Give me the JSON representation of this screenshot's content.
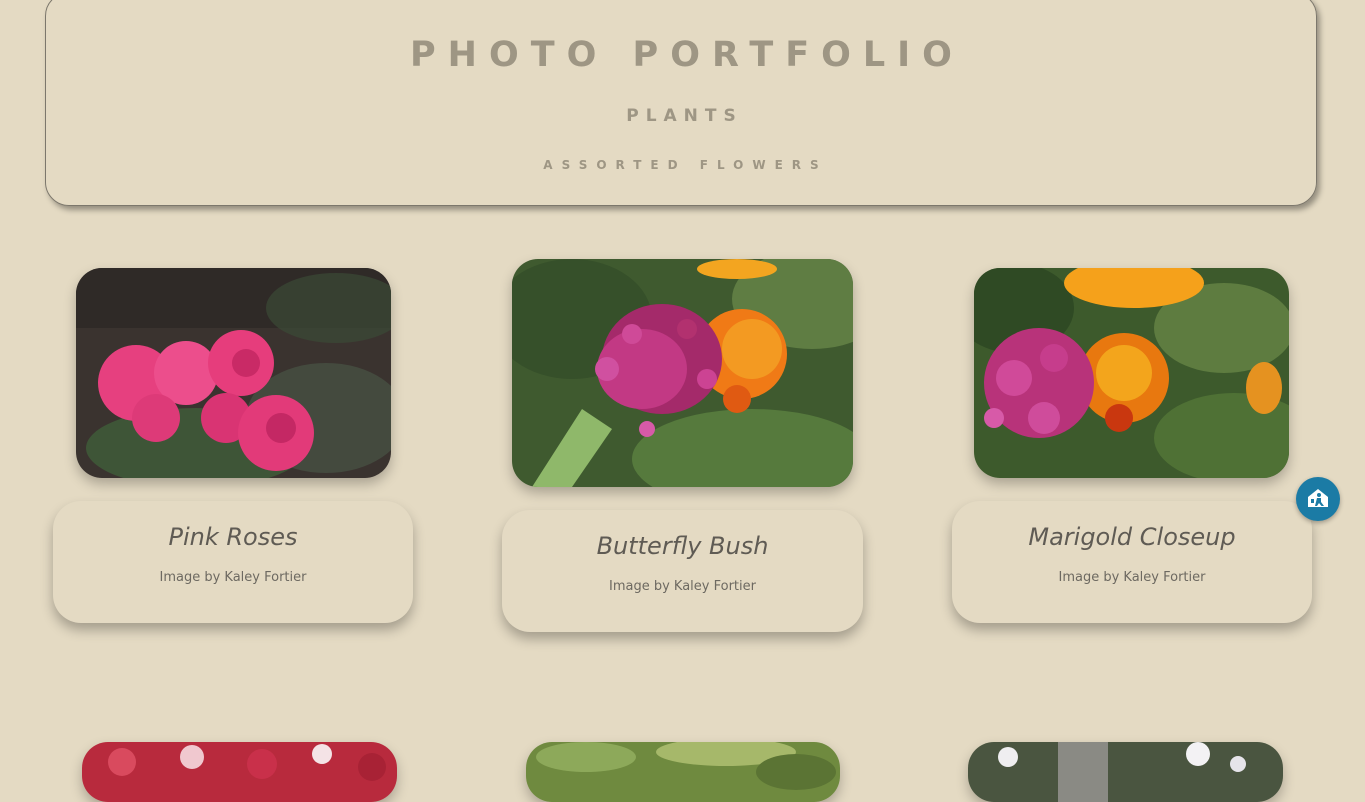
{
  "header": {
    "title": "PHOTO PORTFOLIO",
    "subtitle": "PLANTS",
    "category": "ASSORTED FLOWERS"
  },
  "gallery": [
    {
      "title": "Pink Roses",
      "credit": "Image by Kaley Fortier",
      "image": "pink-roses-photo"
    },
    {
      "title": "Butterfly Bush",
      "credit": "Image by Kaley Fortier",
      "image": "butterfly-bush-photo"
    },
    {
      "title": "Marigold Closeup",
      "credit": "Image by Kaley Fortier",
      "image": "marigold-closeup-photo"
    }
  ],
  "next_row_images": [
    "red-flowers-photo",
    "green-foliage-photo",
    "white-flowers-photo"
  ],
  "accessibility_button": {
    "icon": "accessibility-icon",
    "color": "#1b7ba5"
  },
  "colors": {
    "background": "#e4dac3",
    "heading": "#9e9684",
    "text": "#5f5b54"
  }
}
